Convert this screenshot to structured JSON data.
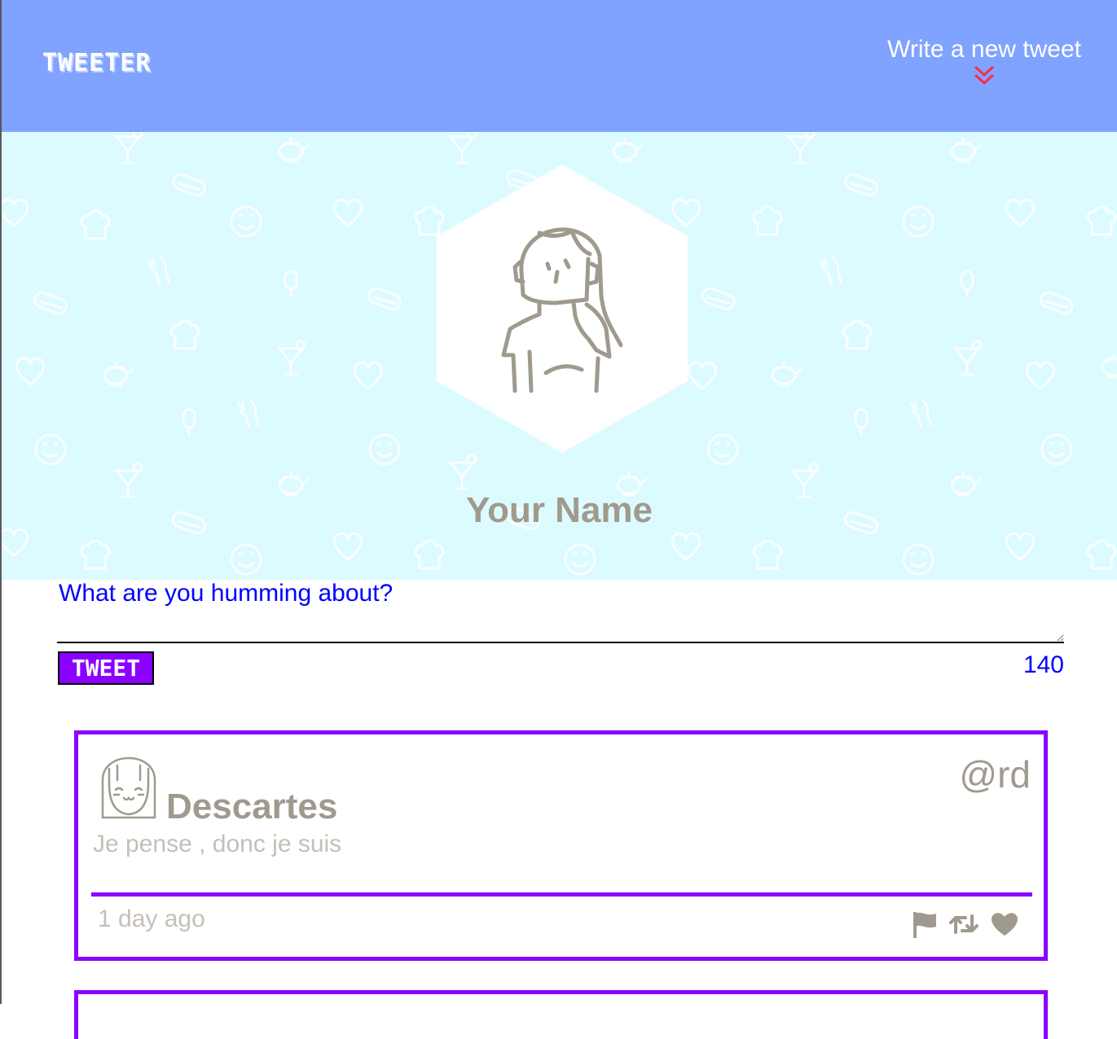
{
  "nav": {
    "brand": "TWEETER",
    "compose_label": "Write a new tweet",
    "compose_icon": "double-chevron-down-icon"
  },
  "profile": {
    "name": "Your Name",
    "avatar_icon": "girl-avatar-icon"
  },
  "composer": {
    "question": "What are you humming about?",
    "input_value": "",
    "button_label": "TWEET",
    "counter": "140"
  },
  "tweets": [
    {
      "name": "Descartes",
      "handle": "@rd",
      "text": "Je pense , donc je suis",
      "time": "1 day ago",
      "actions": [
        "flag-icon",
        "retweet-icon",
        "heart-icon"
      ]
    }
  ],
  "colors": {
    "nav_bg": "#7fa3ff",
    "header_bg": "#dcfbff",
    "accent_purple": "#8b00ff",
    "link_blue": "#0000ff",
    "muted_text": "#a09a8e",
    "chevron_red": "#ff2a4a"
  }
}
